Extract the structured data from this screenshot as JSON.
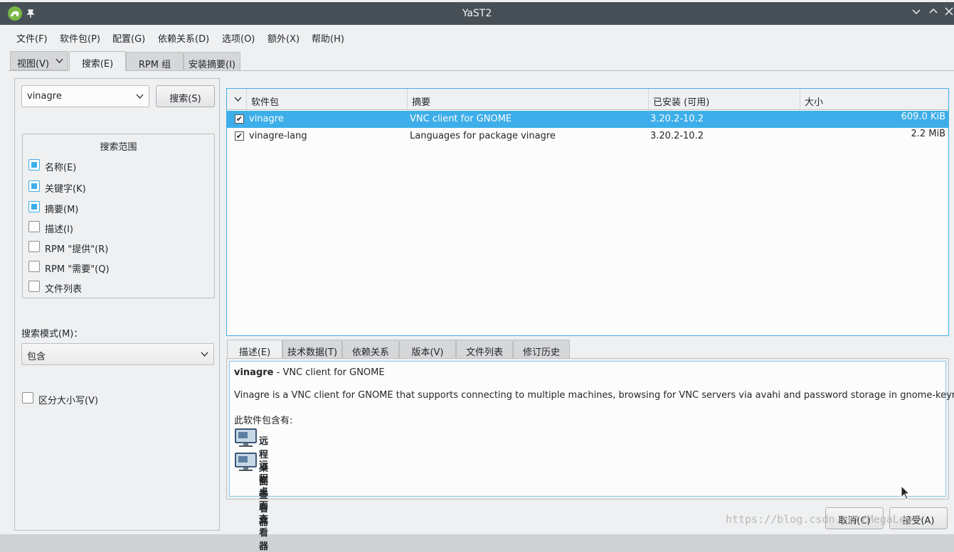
{
  "window": {
    "title": "YaST2"
  },
  "menu": [
    "文件(F)",
    "软件包(P)",
    "配置(G)",
    "依赖关系(D)",
    "选项(O)",
    "额外(X)",
    "帮助(H)"
  ],
  "top_tabs": {
    "view": "视图(V)",
    "search": "搜索(E)",
    "rpm_group": "RPM 组",
    "install_summary": "安装摘要(I)"
  },
  "search": {
    "query": "vinagre",
    "button": "搜索(S)",
    "scope_title": "搜索范围",
    "scope_options": [
      {
        "label": "名称(E)",
        "checked": true
      },
      {
        "label": "关键字(K)",
        "checked": true
      },
      {
        "label": "摘要(M)",
        "checked": true
      },
      {
        "label": "描述(I)",
        "checked": false
      },
      {
        "label": "RPM \"提供\"(R)",
        "checked": false
      },
      {
        "label": "RPM \"需要\"(Q)",
        "checked": false
      },
      {
        "label": "文件列表",
        "checked": false
      }
    ],
    "mode_label": "搜索模式(M)：",
    "mode_value": "包含",
    "case_sensitive": {
      "label": "区分大小写(V)",
      "checked": false
    }
  },
  "table": {
    "headers": {
      "package": "软件包",
      "summary": "摘要",
      "installed": "已安装 (可用)",
      "size": "大小"
    },
    "rows": [
      {
        "package": "vinagre",
        "summary": "VNC client for GNOME",
        "installed": "3.20.2-10.2",
        "size": "609.0 KiB",
        "selected": true
      },
      {
        "package": "vinagre-lang",
        "summary": "Languages for package vinagre",
        "installed": "3.20.2-10.2",
        "size": "2.2 MiB",
        "selected": false
      }
    ]
  },
  "detail_tabs": [
    "描述(E)",
    "技术数据(T)",
    "依赖关系",
    "版本(V)",
    "文件列表",
    "修订历史"
  ],
  "detail": {
    "name": "vinagre",
    "headline_rest": " - VNC client for GNOME",
    "description": "Vinagre is a VNC client for GNOME that supports connecting to multiple machines, browsing for VNC servers via avahi and password storage in gnome-keyring.",
    "contains_label": "此软件包含有:",
    "apps": [
      "远程桌面查看器",
      "远程桌面查看器"
    ]
  },
  "buttons": {
    "cancel": "取消(C)",
    "accept": "接受(A)"
  },
  "watermark": "https://blog.csdn.net/MegaLey"
}
